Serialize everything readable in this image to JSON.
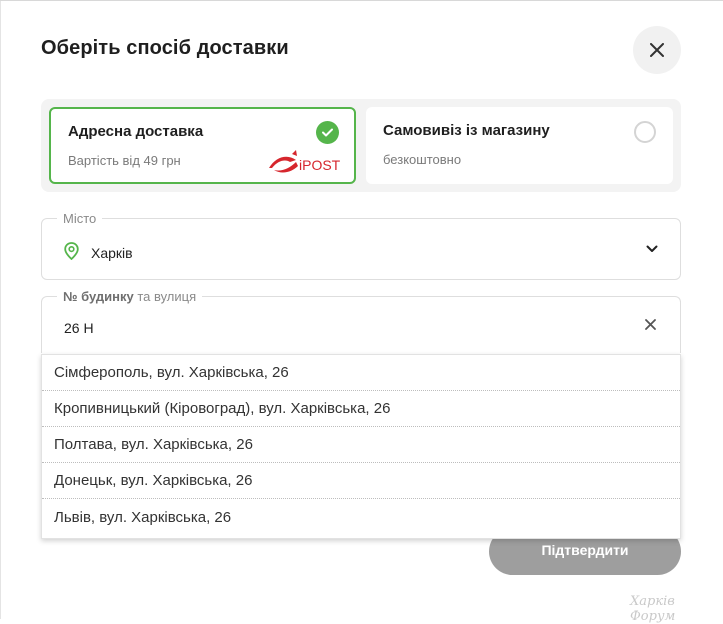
{
  "modal": {
    "title": "Оберіть спосіб доставки",
    "close_icon": "close-icon"
  },
  "delivery_options": {
    "address": {
      "title": "Адресна доставка",
      "subtitle": "Вартість від 49 грн",
      "selected": true,
      "carrier_logo": "iPOST"
    },
    "pickup": {
      "title": "Самовивіз із магазину",
      "subtitle": "безкоштовно",
      "selected": false
    }
  },
  "city_field": {
    "label": "Місто",
    "value": "Харків"
  },
  "street_field": {
    "label_bold": "№ будинку",
    "label_rest": " та вулиця",
    "value": "26 Н"
  },
  "suggestions": [
    "Сімферополь, вул. Харківська, 26",
    "Кропивницький (Кіровоград), вул. Харківська, 26",
    "Полтава, вул. Харківська, 26",
    "Донецьк, вул. Харківська, 26",
    "Львів, вул. Харківська, 26"
  ],
  "confirm_label": "Підтвердити",
  "watermark": "Харків Форум",
  "colors": {
    "accent_green": "#55b54b",
    "button_disabled": "#9e9e9e",
    "ipost_red": "#d6262d"
  }
}
